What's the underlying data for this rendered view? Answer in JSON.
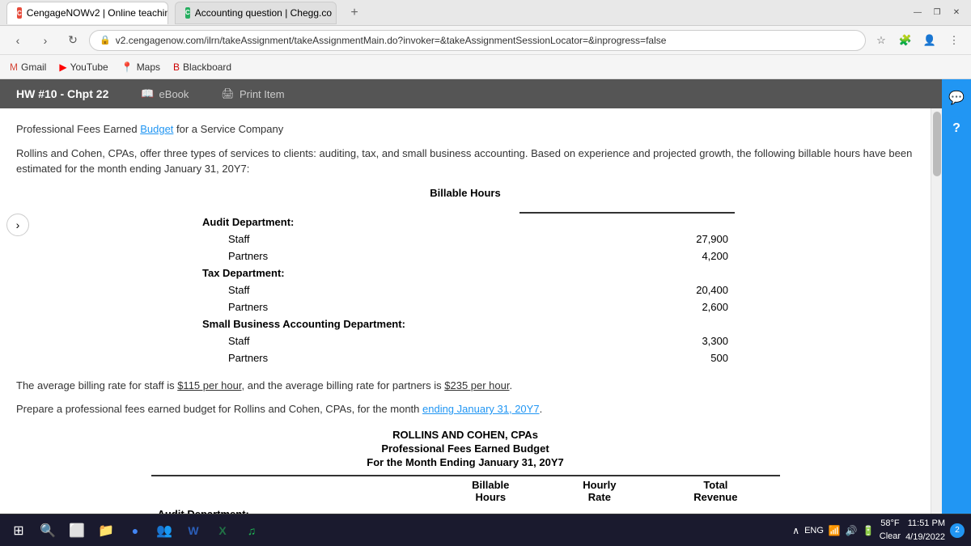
{
  "browser": {
    "tabs": [
      {
        "id": "tab1",
        "favicon_type": "red",
        "label": "CengageNOWv2 | Online teachin",
        "active": true
      },
      {
        "id": "tab2",
        "favicon_type": "green",
        "label": "Accounting question | Chegg.co",
        "active": false
      }
    ],
    "url": "v2.cengagenow.com/ilrn/takeAssignment/takeAssignmentMain.do?invoker=&takeAssignmentSessionLocator=&inprogress=false",
    "bookmarks": [
      {
        "id": "gmail",
        "label": "Gmail",
        "color": "#D44638"
      },
      {
        "id": "youtube",
        "label": "YouTube",
        "color": "#FF0000"
      },
      {
        "id": "maps",
        "label": "Maps",
        "color": "#4285F4"
      },
      {
        "id": "blackboard",
        "label": "Blackboard",
        "color": "#CC0000"
      }
    ]
  },
  "header": {
    "hw_label": "HW #10 - Chpt 22",
    "ebook_label": "eBook",
    "print_label": "Print Item"
  },
  "content": {
    "title_line1": "Professional Fees Earned ",
    "title_link": "Budget",
    "title_line2": " for a Service Company",
    "intro": "Rollins and Cohen, CPAs, offer three types of services to clients: auditing, tax, and small business accounting. Based on experience and projected growth, the following billable hours have been estimated for the month ending January 31, 20Y7:",
    "billable_hours_title": "Billable Hours",
    "departments": [
      {
        "name": "Audit Department:",
        "rows": [
          {
            "label": "Staff",
            "value": "27,900"
          },
          {
            "label": "Partners",
            "value": "4,200"
          }
        ]
      },
      {
        "name": "Tax Department:",
        "rows": [
          {
            "label": "Staff",
            "value": "20,400"
          },
          {
            "label": "Partners",
            "value": "2,600"
          }
        ]
      },
      {
        "name": "Small Business Accounting Department:",
        "rows": [
          {
            "label": "Staff",
            "value": "3,300"
          },
          {
            "label": "Partners",
            "value": "500"
          }
        ]
      }
    ],
    "avg_billing_text_before": "The average billing rate for staff is ",
    "avg_billing_staff": "$115 per hour",
    "avg_billing_mid": ", and the average billing rate for partners is ",
    "avg_billing_partners": "$235 per hour",
    "avg_billing_end": ".",
    "prepare_text_before": "Prepare a professional fees earned budget for Rollins and Cohen, CPAs, for the month ",
    "prepare_text_link": "ending January 31, 20Y7",
    "prepare_text_end": ".",
    "budget_company": "ROLLINS AND COHEN, CPAs",
    "budget_title": "Professional Fees Earned Budget",
    "budget_period": "For the Month Ending January 31, 20Y7",
    "budget_col1": "Billable",
    "budget_col1b": "Hours",
    "budget_col2": "Hourly",
    "budget_col2b": "Rate",
    "budget_col3": "Total",
    "budget_col3b": "Revenue",
    "budget_dept_label": "Audit Department:"
  },
  "taskbar": {
    "weather_temp": "58°F",
    "weather_desc": "Clear",
    "time": "11:51 PM",
    "date": "4/19/2022",
    "lang": "ENG",
    "notif_count": "2"
  }
}
